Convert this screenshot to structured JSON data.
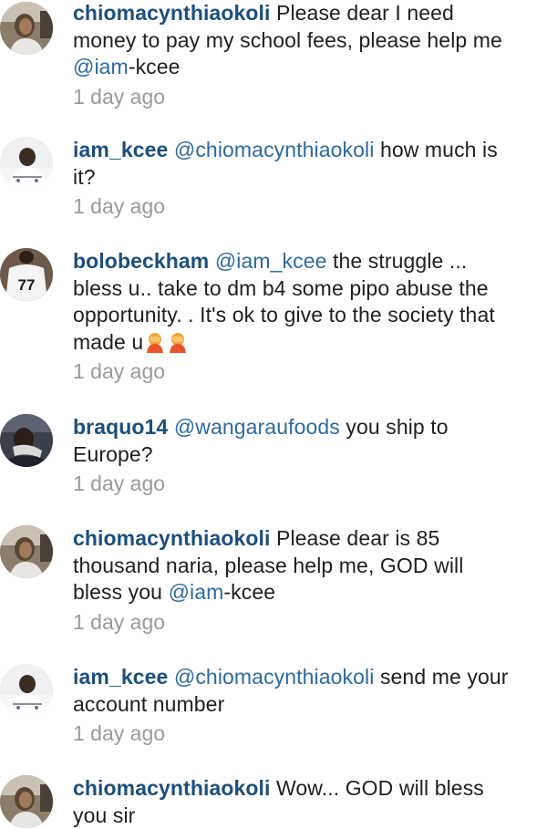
{
  "comments": [
    {
      "username": "chiomacynthiaokoli",
      "text_before": " Please dear I need money to pay my school fees, please help me ",
      "mention": "@iam",
      "text_after": "-kcee",
      "timestamp": "1 day ago",
      "avatar_icon": "user-avatar-photo"
    },
    {
      "username": "iam_kcee",
      "mention": " @chiomacynthiaokoli",
      "text_after": " how much is it?",
      "timestamp": "1 day ago",
      "avatar_icon": "user-avatar-photo"
    },
    {
      "username": "bolobeckham",
      "mention": " @iam_kcee",
      "text_after": " the struggle ... bless u.. take to dm b4 some pipo abuse the opportunity. . It's ok to give to the society that made u",
      "emoji": "face-palm-emoji",
      "timestamp": "1 day ago",
      "avatar_icon": "user-avatar-jersey-77"
    },
    {
      "username": "braquo14",
      "mention": " @wangaraufoods",
      "text_after": " you ship to Europe?",
      "timestamp": "1 day ago",
      "avatar_icon": "user-avatar-photo"
    },
    {
      "username": "chiomacynthiaokoli",
      "text_before": " Please dear is 85 thousand naria, please help me, GOD will bless you ",
      "mention": "@iam",
      "text_after": "-kcee",
      "timestamp": "1 day ago",
      "avatar_icon": "user-avatar-photo"
    },
    {
      "username": "iam_kcee",
      "mention": " @chiomacynthiaokoli",
      "text_after": " send me your account number",
      "timestamp": "1 day ago",
      "avatar_icon": "user-avatar-photo"
    },
    {
      "username": "chiomacynthiaokoli",
      "text_before": " Wow... GOD will bless you sir",
      "avatar_icon": "user-avatar-photo"
    }
  ],
  "jersey_number": "77",
  "colors": {
    "username": "#1c4f7c",
    "mention": "#2d6aa0",
    "text": "#1f1f1f",
    "timestamp": "#9a9a9a"
  }
}
